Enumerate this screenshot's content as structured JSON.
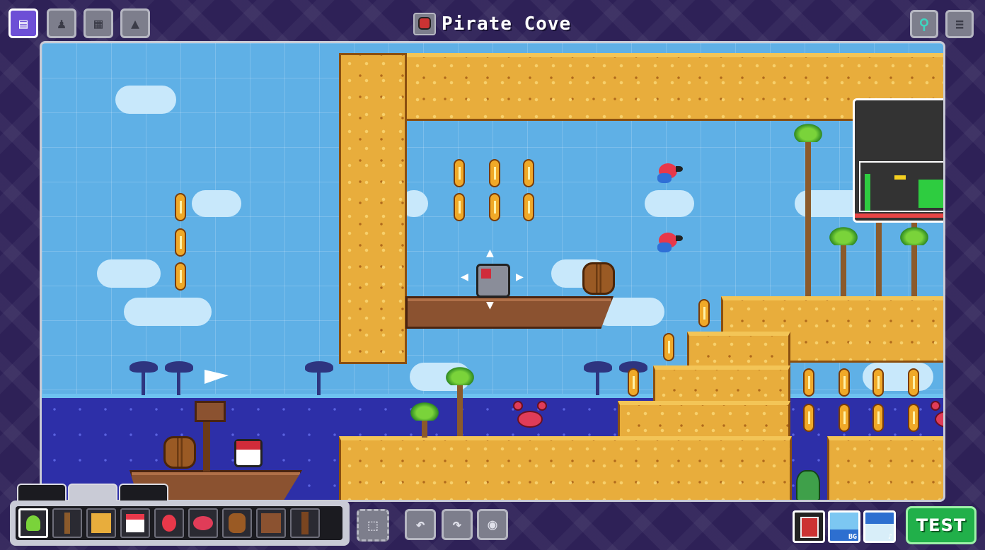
{
  "window": {
    "title": "Pirate Cove"
  },
  "top_toolbar": {
    "left_buttons": [
      {
        "name": "level-editor-tab",
        "icon": "level-icon"
      },
      {
        "name": "character-tab",
        "icon": "character-icon"
      },
      {
        "name": "blocks-tab",
        "icon": "blocks-icon"
      },
      {
        "name": "scenery-tab",
        "icon": "mountains-icon"
      }
    ],
    "right_buttons": [
      {
        "name": "gamepad-button",
        "icon": "gamepad-icon"
      },
      {
        "name": "menu-button",
        "icon": "hamburger-menu-icon"
      }
    ]
  },
  "palette": {
    "tabs": [
      {
        "name": "tab-terrain",
        "icon": "terrain-strip-icon"
      },
      {
        "name": "tab-objects",
        "icon": "objects-icon"
      },
      {
        "name": "tab-tools",
        "icon": "tools-icon"
      }
    ],
    "items": [
      {
        "name": "palm-tree",
        "icon": "palm-tree-icon",
        "color": "#7ad33a",
        "selected": true
      },
      {
        "name": "wooden-post",
        "icon": "post-icon",
        "color": "#8b5a2b"
      },
      {
        "name": "sand-block",
        "icon": "sand-block-icon",
        "color": "#e8ad3c"
      },
      {
        "name": "pirate-enemy",
        "icon": "pirate-icon",
        "color": "#e8384a"
      },
      {
        "name": "parrot-enemy",
        "icon": "parrot-icon",
        "color": "#e8384a"
      },
      {
        "name": "crab-enemy",
        "icon": "crab-icon",
        "color": "#e03c58"
      },
      {
        "name": "barrel",
        "icon": "barrel-icon",
        "color": "#9a5a24"
      },
      {
        "name": "crate",
        "icon": "crate-icon",
        "color": "#8b5230"
      },
      {
        "name": "wood-pillar",
        "icon": "pillar-icon",
        "color": "#7a4520"
      }
    ]
  },
  "bottom_toolbar": {
    "select_button": "selection-icon",
    "undo_button": "undo-icon",
    "redo_button": "redo-icon",
    "screenshot_button": "camera-icon",
    "thumbs": [
      {
        "name": "player-thumb",
        "label": ""
      },
      {
        "name": "background-thumb",
        "label": "BG"
      },
      {
        "name": "music-thumb",
        "label": "♪"
      }
    ],
    "test_label": "TEST"
  },
  "colors": {
    "frame": "#2e2157",
    "sky": "#5fb0e6",
    "sea": "#2d2fa8",
    "sand": "#e8ad3c",
    "test_button": "#21b04a",
    "active_tab": "#6d4fd6"
  }
}
